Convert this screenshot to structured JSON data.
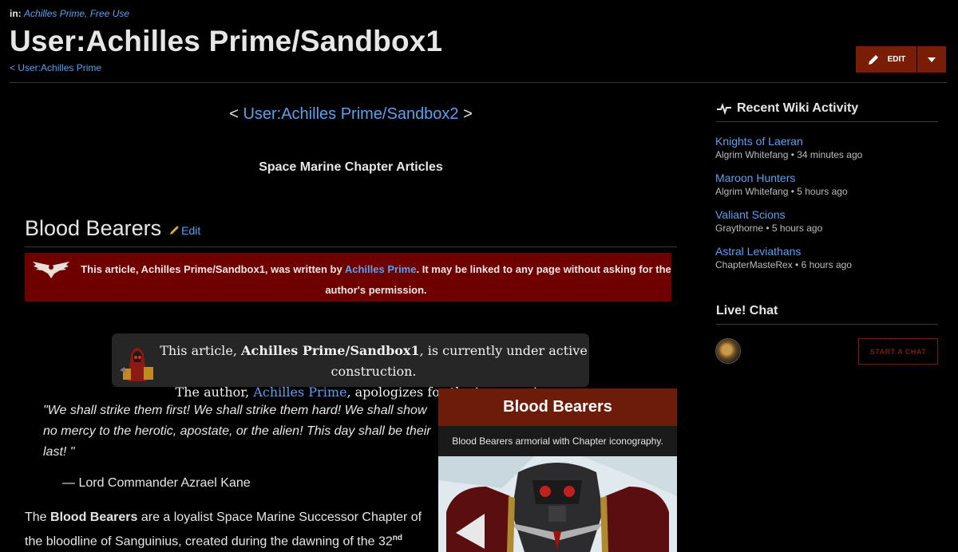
{
  "breadcrumb": {
    "prefix": "in:",
    "links": "Achilles Prime, Free Use"
  },
  "header": {
    "title": "User:Achilles Prime/Sandbox1",
    "parent_link": "< User:Achilles Prime",
    "edit_label": "EDIT"
  },
  "article": {
    "sandbox_nav": {
      "left": "<",
      "link": "User:Achilles Prime/Sandbox2",
      "right": ">"
    },
    "articles_title": "Space Marine Chapter Articles",
    "section_title": "Blood Bearers",
    "section_edit": "Edit",
    "notice_banner": {
      "text_before": "This article, Achilles Prime/Sandbox1, was written by ",
      "author_link": "Achilles Prime",
      "text_after": ". It may be linked to any page without asking for the author's permission."
    },
    "construction_box": {
      "line1_before": "This article, ",
      "line1_bold": "Achilles Prime/Sandbox1",
      "line1_after": ", is currently under active construction.",
      "line2_before": "The author, ",
      "line2_link": "Achilles Prime",
      "line2_after": ", apologizes for the inconvenience."
    },
    "quote": "\"We shall strike them first! We shall strike them hard! We shall show no mercy to the herotic, apostate, or the alien! This day shall be their last! \"",
    "attribution": "— Lord Commander Azrael Kane",
    "body": {
      "before": "The ",
      "bold": "Blood Bearers",
      "after": " are a loyalist Space Marine Successor Chapter of the bloodline of Sanguinius, created during the dawning of the 32",
      "sup": "nd"
    }
  },
  "infobox": {
    "title": "Blood Bearers",
    "caption": "Blood Bearers armorial with Chapter iconography."
  },
  "sidebar": {
    "activity_title": "Recent Wiki Activity",
    "activity": [
      {
        "title": "Knights of Laeran",
        "meta": "Algrim Whitefang • 34 minutes ago"
      },
      {
        "title": "Maroon Hunters",
        "meta": "Algrim Whitefang • 5 hours ago"
      },
      {
        "title": "Valiant Scions",
        "meta": "Graythorne • 5 hours ago"
      },
      {
        "title": "Astral Leviathans",
        "meta": "ChapterMasteRex • 6 hours ago"
      }
    ],
    "chat_title": "Live! Chat",
    "chat_button": "START A CHAT"
  },
  "colors": {
    "link": "#5aa0f0",
    "accent": "#7a1d06",
    "banner": "#6e0000",
    "background": "#000000"
  },
  "icons": [
    "pencil-icon",
    "caret-down-icon",
    "activity-pulse-icon",
    "aquila-icon",
    "tech-priest-icon",
    "chat-avatar"
  ]
}
